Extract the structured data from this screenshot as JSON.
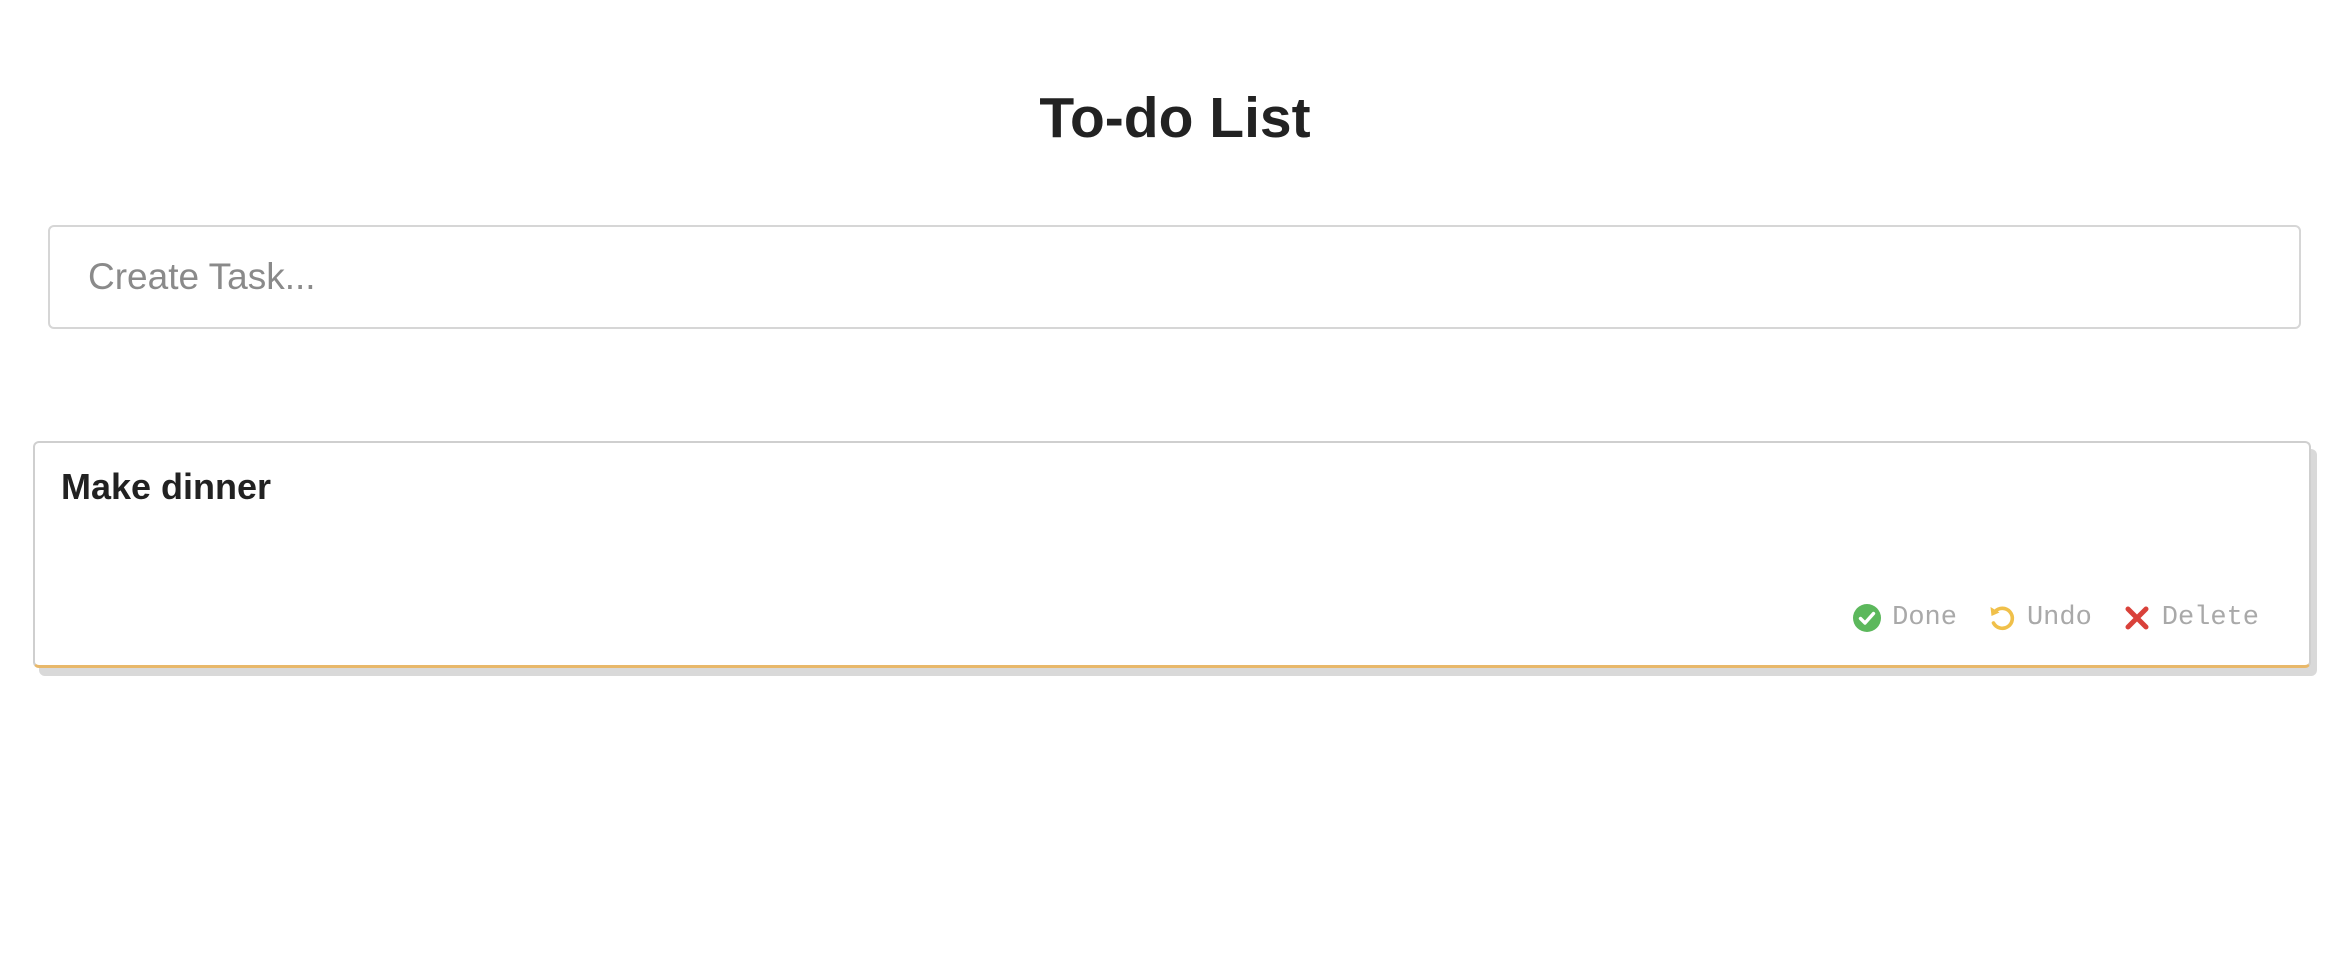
{
  "page": {
    "title": "To-do List"
  },
  "create": {
    "placeholder": "Create Task...",
    "value": ""
  },
  "tasks": [
    {
      "title": "Make dinner",
      "actions": {
        "done_label": "Done",
        "undo_label": "Undo",
        "delete_label": "Delete"
      }
    }
  ],
  "icons": {
    "done": "check-circle-icon",
    "undo": "undo-icon",
    "delete": "close-icon"
  },
  "colors": {
    "done": "#5cb85c",
    "undo": "#f0c04a",
    "delete": "#d9413a",
    "card_accent": "#e8b86a",
    "action_text": "#a9a9a9"
  }
}
